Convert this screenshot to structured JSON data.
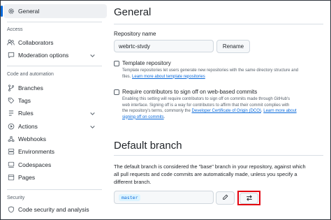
{
  "sidebar": {
    "general": "General",
    "section_access": "Access",
    "collaborators": "Collaborators",
    "moderation": "Moderation options",
    "section_code": "Code and automation",
    "branches": "Branches",
    "tags": "Tags",
    "rules": "Rules",
    "actions": "Actions",
    "webhooks": "Webhooks",
    "environments": "Environments",
    "codespaces": "Codespaces",
    "pages": "Pages",
    "section_security": "Security",
    "code_security": "Code security and analysis"
  },
  "main": {
    "title": "General",
    "repo_name_label": "Repository name",
    "repo_name_value": "webrtc-stvdy",
    "rename_label": "Rename",
    "template": {
      "title": "Template repository",
      "help_1": "Template repositories let users generate new repositories with the same directory structure and",
      "help_2": "files.",
      "link": "Learn more about template repositories"
    },
    "signoff": {
      "title": "Require contributors to sign off on web-based commits",
      "help_1": "Enabling this setting will require contributors to sign off on commits made through GitHub's",
      "help_2": "web interface. Signing off is a way for contributors to affirm that their commit complies with",
      "help_3": "the repository's terms, commonly the",
      "link_dco": "Developer Certificate of Origin (DCO)",
      "link_more_a": "Learn more about",
      "link_more_b": "signing off on commits"
    },
    "default_branch_title": "Default branch",
    "default_branch_desc_1": "The default branch is considered the \"base\" branch in your repository, against which",
    "default_branch_desc_2": "all pull requests and code commits are automatically made, unless you specify a",
    "default_branch_desc_3": "different branch.",
    "branch_name": "master"
  },
  "colors": {
    "accent": "#0969da",
    "highlight": "#e3000f"
  }
}
